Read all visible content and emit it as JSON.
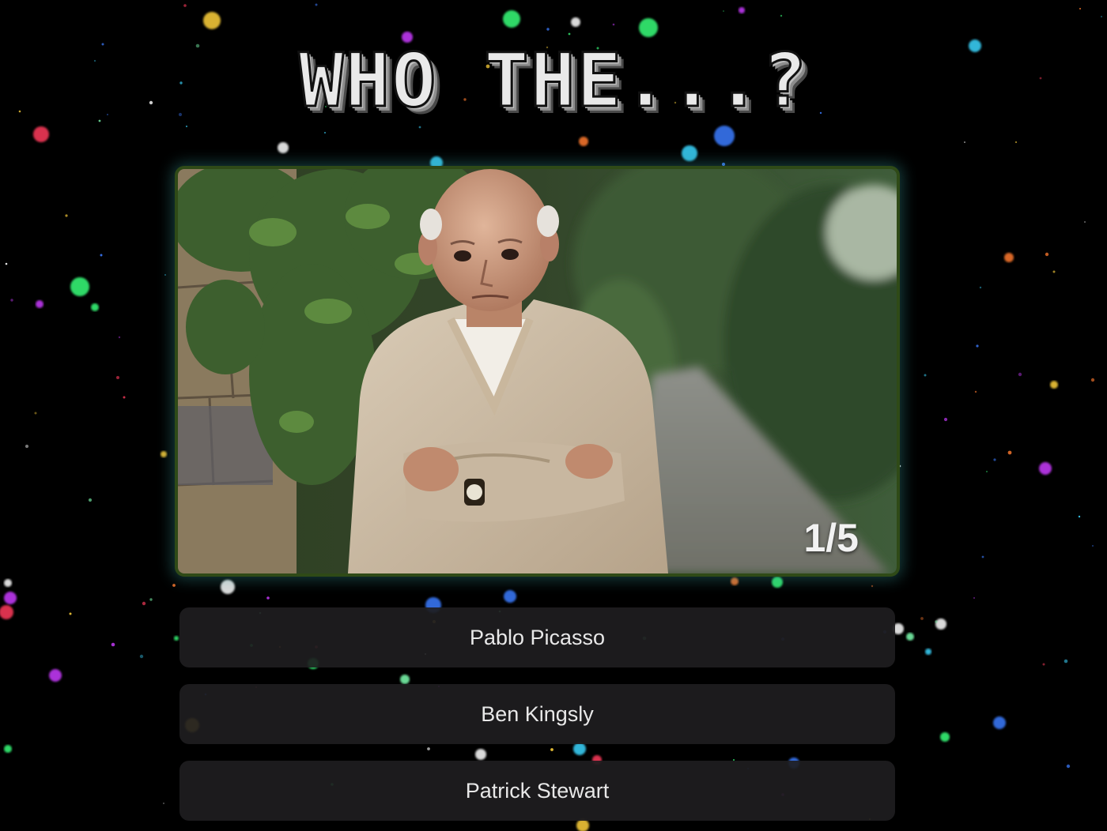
{
  "title": "WHO THE...?",
  "round": {
    "counter": "1/5",
    "current": 1,
    "total": 5
  },
  "photo": {
    "subject": "portrait-of-elderly-man-in-cream-sweater"
  },
  "answers": [
    {
      "label": "Pablo Picasso"
    },
    {
      "label": "Ben Kingsly"
    },
    {
      "label": "Patrick Stewart"
    }
  ],
  "colors": {
    "background": "#000000",
    "frame_border": "#2f4a17",
    "button_bg": "#1e1d20",
    "confetti": [
      "#ff3b5c",
      "#39ff7a",
      "#3ad6ff",
      "#c93bff",
      "#ffd23b",
      "#ff7a2e",
      "#3b7bff",
      "#ffffff",
      "#7dffb0"
    ]
  }
}
